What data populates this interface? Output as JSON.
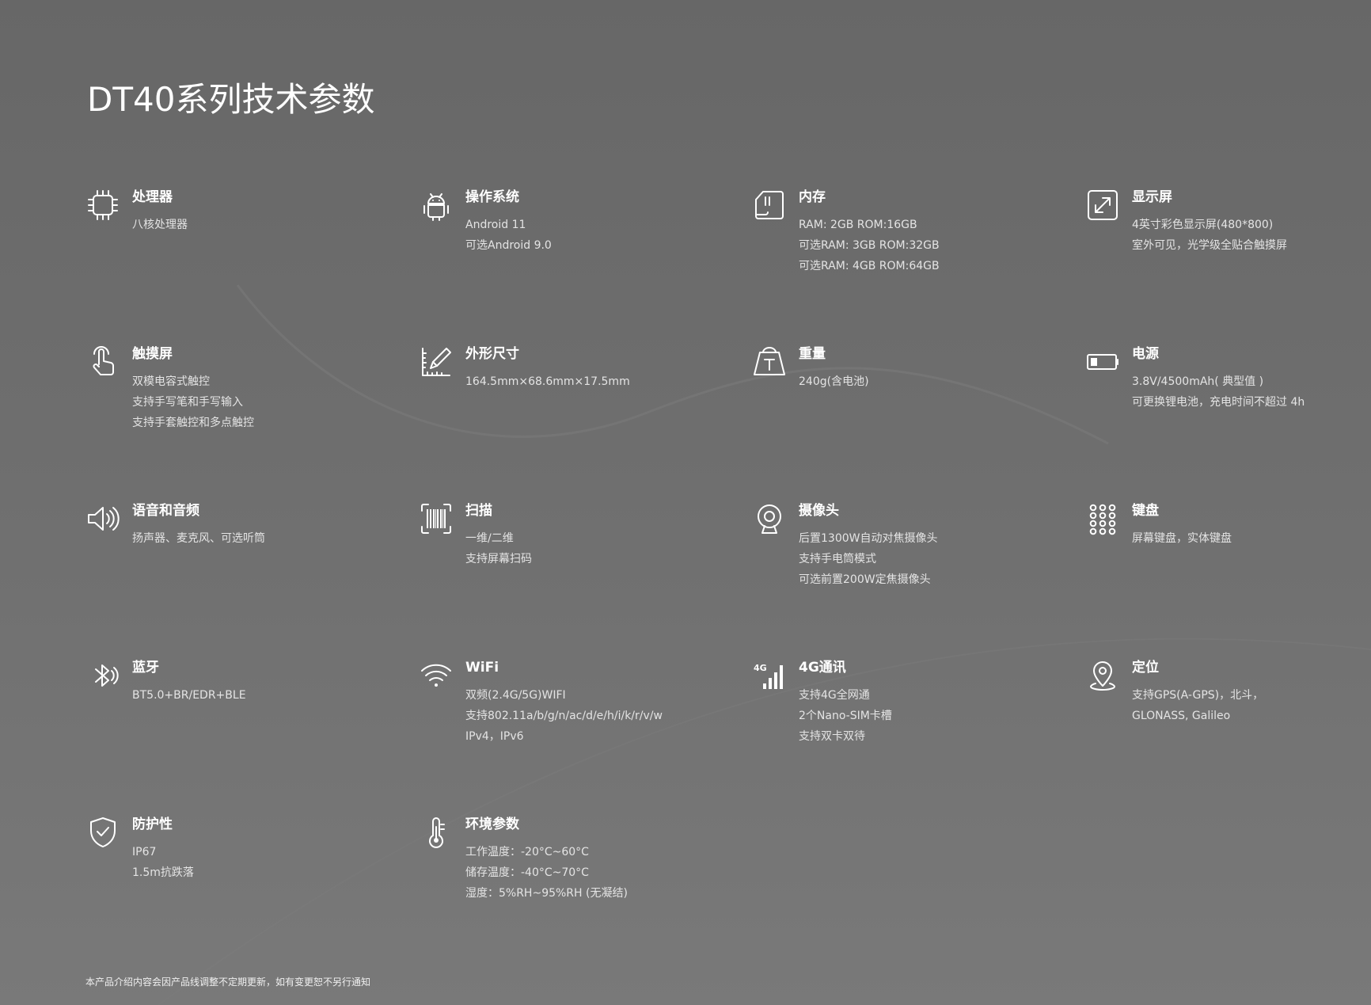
{
  "page": {
    "title": "DT40系列技术参数",
    "footnote": "本产品介绍内容会因产品线调整不定期更新，如有变更恕不另行通知"
  },
  "specs": [
    {
      "icon": "cpu-icon",
      "title": "处理器",
      "lines": [
        "八核处理器"
      ]
    },
    {
      "icon": "android-icon",
      "title": "操作系统",
      "lines": [
        "Android 11",
        "可选Android 9.0"
      ]
    },
    {
      "icon": "sd-card-icon",
      "title": "内存",
      "lines": [
        "RAM: 2GB ROM:16GB",
        "可选RAM: 3GB ROM:32GB",
        "可选RAM: 4GB ROM:64GB"
      ]
    },
    {
      "icon": "expand-screen-icon",
      "title": "显示屏",
      "lines": [
        "4英寸彩色显示屏(480*800)",
        "室外可见，光学级全贴合触摸屏"
      ]
    },
    {
      "icon": "touch-hand-icon",
      "title": "触摸屏",
      "lines": [
        "双模电容式触控",
        "支持手写笔和手写输入",
        "支持手套触控和多点触控"
      ]
    },
    {
      "icon": "ruler-pen-icon",
      "title": "外形尺寸",
      "lines": [
        "164.5mm×68.6mm×17.5mm"
      ]
    },
    {
      "icon": "weight-icon",
      "title": "重量",
      "lines": [
        "240g(含电池)"
      ]
    },
    {
      "icon": "battery-icon",
      "title": "电源",
      "lines": [
        "3.8V/4500mAh( 典型值 )",
        "可更换锂电池，充电时间不超过 4h"
      ]
    },
    {
      "icon": "speaker-icon",
      "title": "语音和音频",
      "lines": [
        "扬声器、麦克风、可选听筒"
      ]
    },
    {
      "icon": "barcode-scan-icon",
      "title": "扫描",
      "lines": [
        "一维/二维",
        "支持屏幕扫码"
      ]
    },
    {
      "icon": "webcam-icon",
      "title": "摄像头",
      "lines": [
        "后置1300W自动对焦摄像头",
        "支持手电筒模式",
        "可选前置200W定焦摄像头"
      ]
    },
    {
      "icon": "keypad-icon",
      "title": "键盘",
      "lines": [
        "屏幕键盘，实体键盘"
      ]
    },
    {
      "icon": "bluetooth-icon",
      "title": "蓝牙",
      "lines": [
        "BT5.0+BR/EDR+BLE"
      ]
    },
    {
      "icon": "wifi-icon",
      "title": "WiFi",
      "lines": [
        "双频(2.4G/5G)WIFI",
        "支持802.11a/b/g/n/ac/d/e/h/i/k/r/v/w",
        "IPv4，IPv6"
      ]
    },
    {
      "icon": "signal-4g-icon",
      "title": "4G通讯",
      "lines": [
        "支持4G全网通",
        "2个Nano-SIM卡槽",
        "支持双卡双待"
      ]
    },
    {
      "icon": "location-pin-icon",
      "title": "定位",
      "lines": [
        "支持GPS(A-GPS)，北斗，",
        "GLONASS, Galileo"
      ]
    },
    {
      "icon": "shield-check-icon",
      "title": "防护性",
      "lines": [
        "IP67",
        "1.5m抗跌落"
      ]
    },
    {
      "icon": "thermometer-icon",
      "title": "环境参数",
      "lines": [
        "工作温度：-20°C~60°C",
        "储存温度：-40°C~70°C",
        "湿度：5%RH~95%RH (无凝结)"
      ]
    }
  ]
}
